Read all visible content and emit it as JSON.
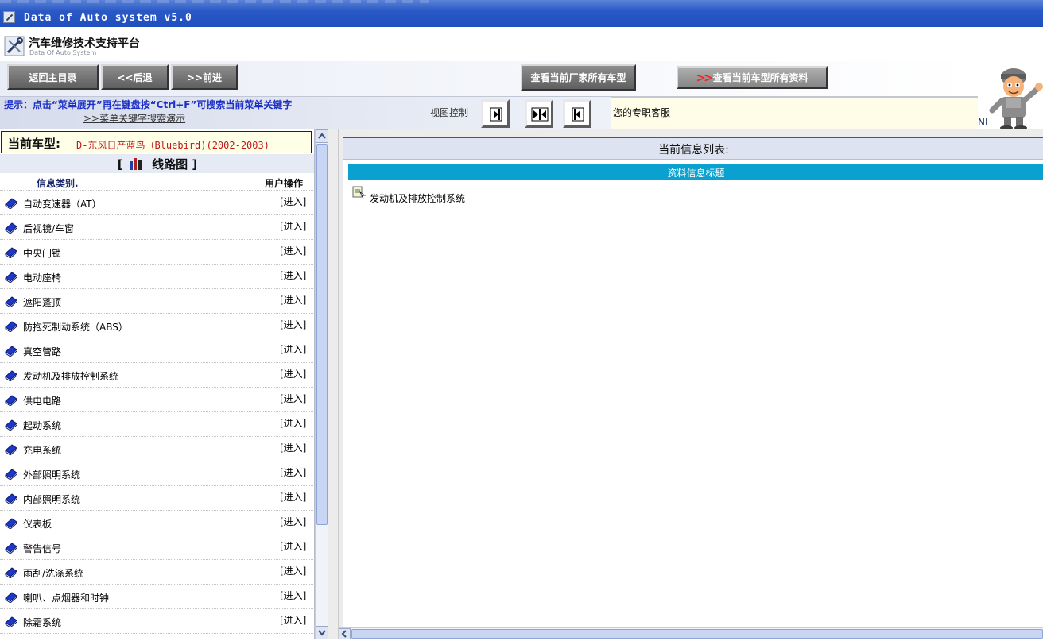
{
  "window": {
    "title": "Data of Auto system v5.0"
  },
  "header": {
    "title": "汽车维修技术支持平台",
    "subtitle": "Data Of Auto System"
  },
  "toolbar": {
    "home_label": "返回主目录",
    "back_label": "<<后退",
    "forward_label": ">>前进",
    "models_label": "查看当前厂家所有车型",
    "alldata_label": "查看当前车型所有资料"
  },
  "hint": {
    "text": "提示：点击“菜单展开”再在键盘按“Ctrl+F”可搜索当前菜单关键字",
    "demo_link": ">>菜单关键字搜索演示",
    "view_control": "视图控制",
    "service": "您的专职客服"
  },
  "mascot": {
    "label": "NL"
  },
  "left": {
    "current_label": "当前车型:",
    "current_value": "D-东风日产蓝鸟（Bluebird)(2002-2003)",
    "section_open": "[",
    "section_title": "线路图",
    "section_close": "]",
    "col_category": "信息类别.",
    "col_action": "用户操作",
    "enter_label": "[进入]",
    "items": [
      "自动变速器（AT）",
      "后视镜/车窗",
      "中央门锁",
      "电动座椅",
      "遮阳蓬顶",
      "防抱死制动系统（ABS）",
      "真空管路",
      "发动机及排放控制系统",
      "供电电路",
      "起动系统",
      "充电系统",
      "外部照明系统",
      "内部照明系统",
      "仪表板",
      "警告信号",
      "雨刮/洗涤系统",
      "喇叭、点烟器和时钟",
      "除霜系统"
    ]
  },
  "right": {
    "title": "当前信息列表:",
    "header": "资料信息标题",
    "items": [
      "发动机及排放控制系统"
    ]
  }
}
